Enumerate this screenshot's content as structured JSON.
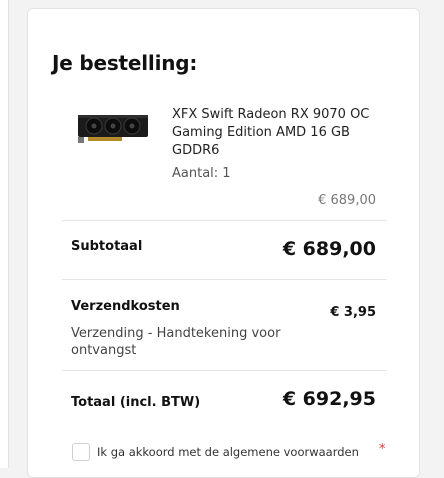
{
  "order": {
    "title": "Je bestelling:",
    "product": {
      "name": "XFX Swift Radeon RX 9070 OC Gaming Edition AMD 16 GB GDDR6",
      "quantity_text": "Aantal: 1",
      "price": "€ 689,00",
      "image_icon": "graphics-card-image"
    },
    "subtotal": {
      "label": "Subtotaal",
      "amount": "€ 689,00"
    },
    "shipping": {
      "label": "Verzendkosten",
      "amount": "€ 3,95",
      "description": "Verzending - Handtekening voor ontvangst"
    },
    "total": {
      "label": "Totaal (incl. BTW)",
      "amount": "€ 692,95"
    },
    "terms": {
      "label": "Ik ga akkoord met de algemene voorwaarden",
      "required_marker": "*",
      "checked": false
    }
  },
  "colors": {
    "background": "#f3f3f3",
    "card": "#ffffff",
    "required": "#e23a3a"
  }
}
